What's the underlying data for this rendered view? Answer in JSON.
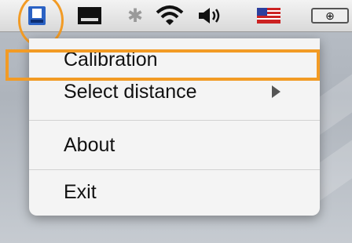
{
  "menubar": {
    "icons": [
      "app-icon",
      "display-icon",
      "bluetooth-icon",
      "wifi-icon",
      "volume-icon",
      "flag-icon",
      "battery-icon"
    ],
    "highlight_color": "#f29b25"
  },
  "menu": {
    "items": [
      {
        "label": "Calibration"
      },
      {
        "label": "Select distance",
        "has_submenu": true
      },
      {
        "label": "About"
      },
      {
        "label": "Exit"
      }
    ]
  }
}
